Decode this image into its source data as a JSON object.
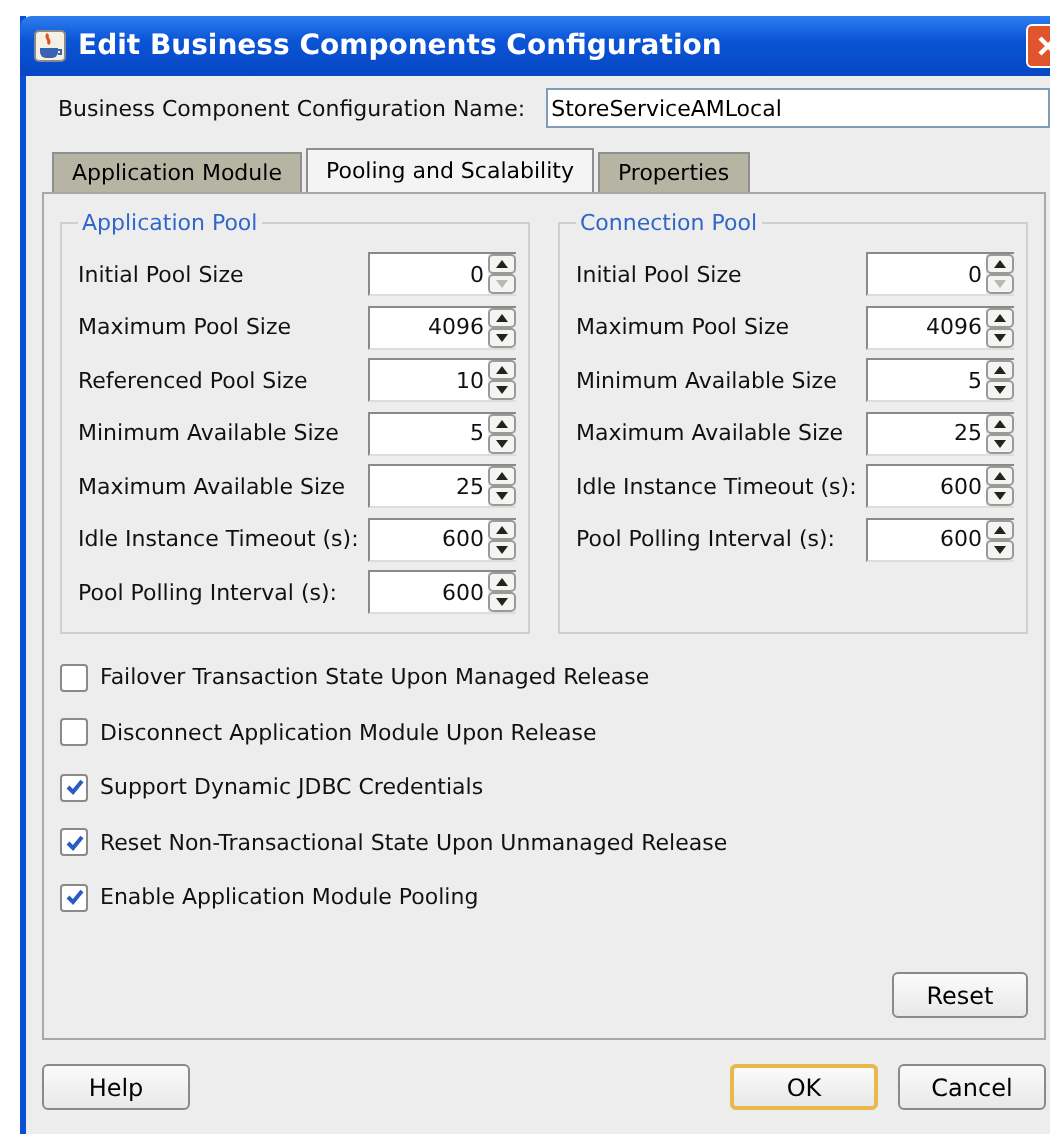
{
  "window": {
    "title": "Edit Business Components Configuration"
  },
  "config_name": {
    "label": "Business Component Configuration Name:",
    "value": "StoreServiceAMLocal"
  },
  "tabs": [
    {
      "label": "Application Module",
      "selected": false
    },
    {
      "label": "Pooling and Scalability",
      "selected": true
    },
    {
      "label": "Properties",
      "selected": false
    }
  ],
  "groups": [
    {
      "title": "Application Pool",
      "fields": [
        {
          "label": "Initial Pool Size",
          "value": "0",
          "down_disabled": true
        },
        {
          "label": "Maximum Pool Size",
          "value": "4096",
          "down_disabled": false
        },
        {
          "label": "Referenced Pool Size",
          "value": "10",
          "down_disabled": false
        },
        {
          "label": "Minimum Available Size",
          "value": "5",
          "down_disabled": false
        },
        {
          "label": "Maximum Available Size",
          "value": "25",
          "down_disabled": false
        },
        {
          "label": "Idle Instance Timeout (s):",
          "value": "600",
          "down_disabled": false
        },
        {
          "label": "Pool Polling Interval (s):",
          "value": "600",
          "down_disabled": false
        }
      ]
    },
    {
      "title": "Connection Pool",
      "fields": [
        {
          "label": "Initial Pool Size",
          "value": "0",
          "down_disabled": true
        },
        {
          "label": "Maximum Pool Size",
          "value": "4096",
          "down_disabled": false
        },
        {
          "label": "Minimum Available Size",
          "value": "5",
          "down_disabled": false
        },
        {
          "label": "Maximum Available Size",
          "value": "25",
          "down_disabled": false
        },
        {
          "label": "Idle Instance Timeout (s):",
          "value": "600",
          "down_disabled": false
        },
        {
          "label": "Pool Polling Interval (s):",
          "value": "600",
          "down_disabled": false
        }
      ]
    }
  ],
  "options": [
    {
      "label": "Failover Transaction State Upon Managed Release",
      "checked": false
    },
    {
      "label": "Disconnect Application Module Upon Release",
      "checked": false
    },
    {
      "label": "Support Dynamic JDBC Credentials",
      "checked": true
    },
    {
      "label": "Reset Non-Transactional State Upon Unmanaged Release",
      "checked": true
    },
    {
      "label": "Enable Application Module Pooling",
      "checked": true
    }
  ],
  "reset_button": "Reset",
  "buttons": [
    {
      "label": "Help",
      "default": false
    },
    {
      "label": "OK",
      "default": true
    },
    {
      "label": "Cancel",
      "default": false
    }
  ]
}
